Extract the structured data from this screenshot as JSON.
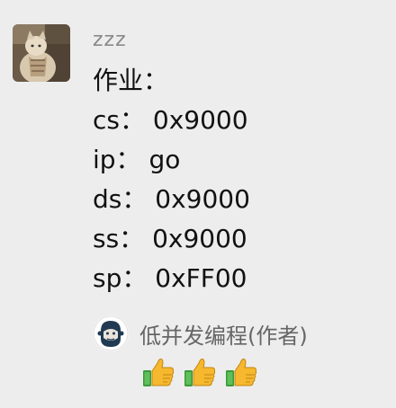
{
  "sender": {
    "name": "zzz",
    "avatar_icon": "cat-photo-avatar"
  },
  "message": {
    "lines": [
      "作业：",
      "cs： 0x9000",
      "ip： go",
      "ds： 0x9000",
      "ss： 0x9000",
      "sp： 0xFF00"
    ]
  },
  "reply": {
    "name": "低并发编程(作者)",
    "avatar_icon": "monkey-avatar",
    "emojis": [
      "thumbs-up-icon",
      "thumbs-up-icon",
      "thumbs-up-icon"
    ]
  },
  "colors": {
    "background": "#ededed",
    "text": "#111111",
    "meta_text": "#8a8a8a",
    "thumb_skin": "#f5b82e",
    "thumb_cuff": "#3c9a3c"
  }
}
